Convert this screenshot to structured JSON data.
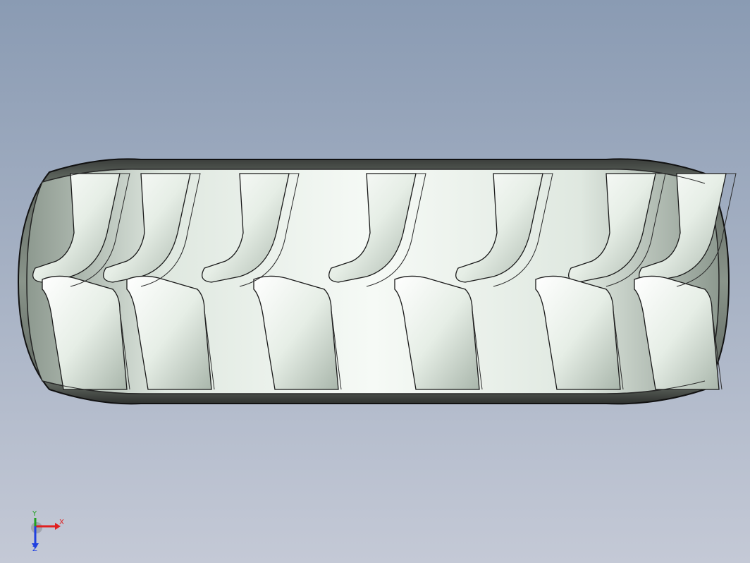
{
  "viewport": {
    "background_top": "#8a9bb3",
    "background_bottom": "#c4c9d6"
  },
  "model": {
    "name": "tire",
    "tread_highlight": "#f7fbf7",
    "tread_mid": "#c9d6cb",
    "tread_shadow": "#7f8c82",
    "edge_color": "#1a1a1a",
    "dark_rim": "#3d3f3d"
  },
  "triad": {
    "x_label": "X",
    "y_label": "Y",
    "z_label": "Z",
    "x_color": "#e02020",
    "y_color": "#20a020",
    "z_color": "#2040e0"
  }
}
